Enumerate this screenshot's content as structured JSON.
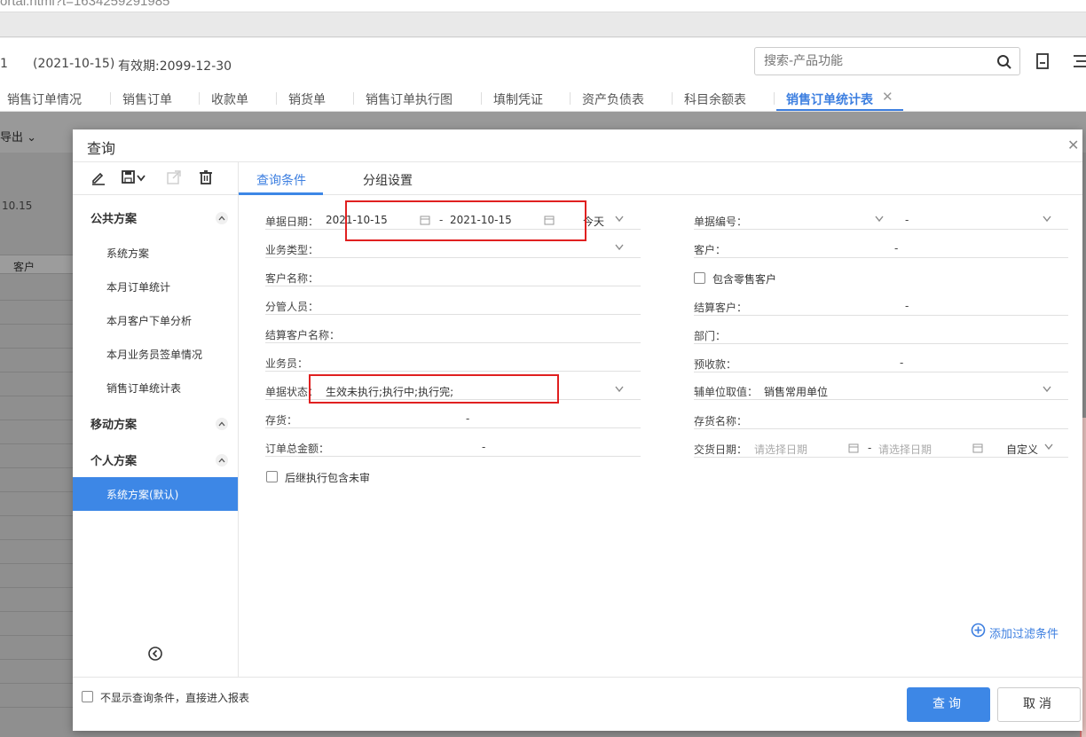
{
  "browser": {
    "url_fragment": "ortal.html?t=1634259291985"
  },
  "header": {
    "account_num": "1",
    "date": "(2021-10-15)",
    "valid_until": "有效期:2099-12-30",
    "search_placeholder": "搜索-产品功能"
  },
  "tabs": [
    {
      "label": "销售订单情况"
    },
    {
      "label": "销售订单"
    },
    {
      "label": "收款单"
    },
    {
      "label": "销货单"
    },
    {
      "label": "销售订单执行图"
    },
    {
      "label": "填制凭证"
    },
    {
      "label": "资产负债表"
    },
    {
      "label": "科目余额表"
    },
    {
      "label": "销售订单统计表",
      "active": true
    }
  ],
  "background": {
    "export_label": "导出",
    "date_fragment": "10.15",
    "column_label": "客户"
  },
  "modal": {
    "title": "查询",
    "left_panel": {
      "groups": [
        {
          "label": "公共方案",
          "items": [
            "系统方案",
            "本月订单统计",
            "本月客户下单分析",
            "本月业务员签单情况",
            "销售订单统计表"
          ]
        },
        {
          "label": "移动方案",
          "items": []
        },
        {
          "label": "个人方案",
          "items": [
            "系统方案(默认)"
          ]
        }
      ],
      "selected": "系统方案(默认)"
    },
    "query_tabs": [
      "查询条件",
      "分组设置"
    ],
    "left_fields": {
      "doc_date": {
        "label": "单据日期：",
        "from": "2021-10-15",
        "to": "2021-10-15",
        "preset": "今天"
      },
      "biz_type": {
        "label": "业务类型："
      },
      "customer_name": {
        "label": "客户名称："
      },
      "manager": {
        "label": "分管人员："
      },
      "settle_customer_name": {
        "label": "结算客户名称："
      },
      "salesperson": {
        "label": "业务员："
      },
      "doc_status": {
        "label": "单据状态：",
        "value": "生效未执行;执行中;执行完;"
      },
      "inventory": {
        "label": "存货："
      },
      "order_total": {
        "label": "订单总金额："
      },
      "subsequent": {
        "label": "后继执行包含未审"
      }
    },
    "right_fields": {
      "doc_number": {
        "label": "单据编号："
      },
      "customer": {
        "label": "客户："
      },
      "include_retail": {
        "label": "包含零售客户"
      },
      "settle_customer": {
        "label": "结算客户："
      },
      "department": {
        "label": "部门："
      },
      "prepaid": {
        "label": "预收款："
      },
      "aux_unit": {
        "label": "辅单位取值：",
        "value": "销售常用单位"
      },
      "inventory_name": {
        "label": "存货名称："
      },
      "delivery_date": {
        "label": "交货日期：",
        "from_placeholder": "请选择日期",
        "to_placeholder": "请选择日期",
        "preset": "自定义"
      }
    },
    "range_dash": "-",
    "add_filter": "添加过滤条件",
    "footer": {
      "skip_label": "不显示查询条件，直接进入报表",
      "query_button": "查询",
      "cancel_button": "取消"
    }
  }
}
